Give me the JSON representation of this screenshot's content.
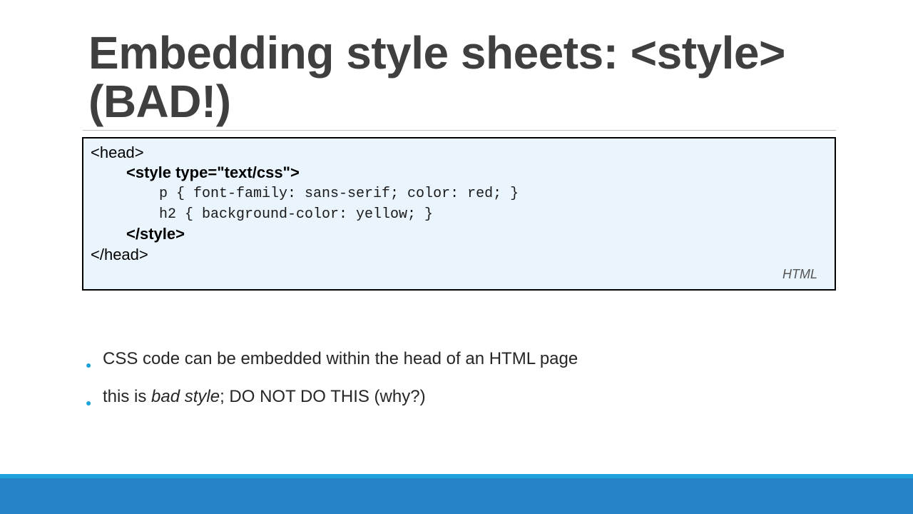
{
  "title": {
    "line1": "Embedding style sheets: <style>",
    "line2": "(BAD!)"
  },
  "code": {
    "lines": [
      "<head>",
      "<style type=\"text/css\">",
      "p { font-family: sans-serif; color: red; }",
      "h2 { background-color: yellow; }",
      "</style>",
      "</head>"
    ],
    "language": "HTML"
  },
  "bullets": [
    {
      "text": "CSS code can be embedded within the head of an HTML page"
    },
    {
      "before": "this is ",
      "emphasis": "bad style",
      "after": "; DO NOT DO THIS (why?)"
    }
  ],
  "colors": {
    "title": "#3f3f3f",
    "code_background": "#e9f4fd",
    "bullet_marker": "#1ca3d8",
    "footer_bar": "#2683c6",
    "footer_strip": "#1ea1dc"
  }
}
